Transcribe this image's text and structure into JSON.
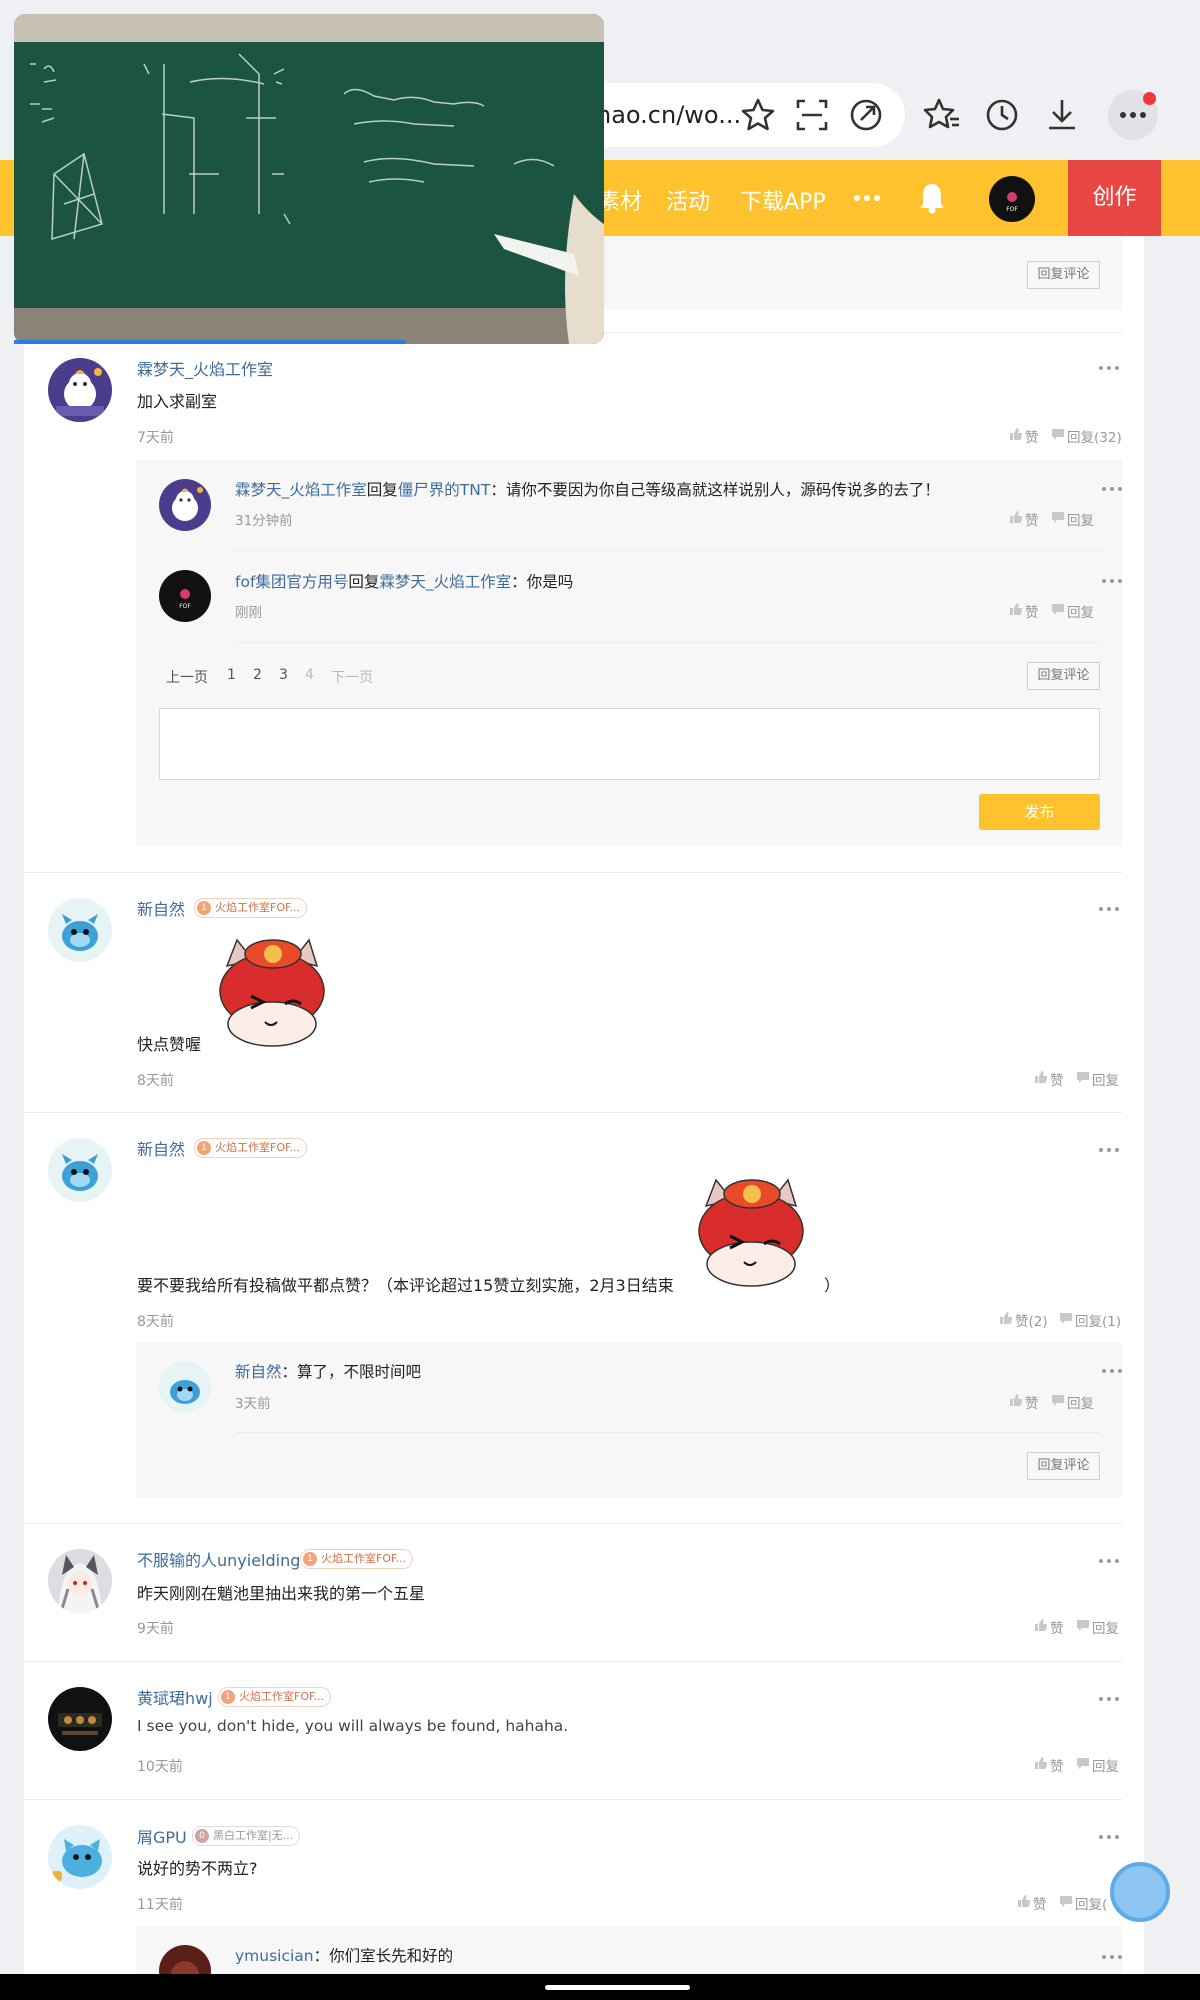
{
  "browser": {
    "url_visible": "hao.cn/wo...",
    "toolbar_icons": [
      "star-icon",
      "screenshot-icon",
      "share-icon",
      "favorites-icon",
      "history-icon",
      "download-icon",
      "more-icon"
    ]
  },
  "nav": {
    "items": [
      "素材",
      "活动",
      "下载APP"
    ],
    "create_label": "创作",
    "colors": {
      "bar": "#fdc22d",
      "create": "#e84744"
    }
  },
  "video": {
    "playing": true
  },
  "top_reply_btn": "回复评论",
  "comments": [
    {
      "author": "霖梦天_火焰工作室",
      "text": "加入求副室",
      "time": "7天前",
      "like": "赞",
      "reply": "回复(32)",
      "replies": [
        {
          "author": "霖梦天_火焰工作室",
          "connector": "回复",
          "target": "僵尸界的TNT",
          "text": "：请你不要因为你自己等级高就这样说别人，源码传说多的去了！",
          "time": "31分钟前",
          "like": "赞",
          "reply": "回复"
        },
        {
          "author": "fof集团官方用号",
          "connector": "回复",
          "target": "霖梦天_火焰工作室",
          "text": "：你是吗",
          "time": "刚刚",
          "like": "赞",
          "reply": "回复"
        }
      ],
      "pagination": {
        "prev": "上一页",
        "pages": [
          "1",
          "2",
          "3",
          "4"
        ],
        "next": "下一页"
      },
      "reply_comment_btn": "回复评论",
      "publish_btn": "发布"
    },
    {
      "author": "新自然",
      "badge_level": "1",
      "badge": "火焰工作室FOF...",
      "text": "快点赞喔",
      "time": "8天前",
      "like": "赞",
      "reply": "回复"
    },
    {
      "author": "新自然",
      "badge_level": "1",
      "badge": "火焰工作室FOF...",
      "text": "要不要我给所有投稿做平都点赞？（本评论超过15赞立刻实施，2月3日结束",
      "text_end": "）",
      "time": "8天前",
      "like": "赞(2)",
      "reply": "回复(1)",
      "replies": [
        {
          "author": "新自然",
          "text": "：算了，不限时间吧",
          "time": "3天前",
          "like": "赞",
          "reply": "回复"
        }
      ],
      "reply_comment_btn": "回复评论"
    },
    {
      "author": "不服输的人unyielding",
      "badge_level": "1",
      "badge": "火焰工作室FOF...",
      "text": "昨天刚刚在魈池里抽出来我的第一个五星",
      "time": "9天前",
      "like": "赞",
      "reply": "回复"
    },
    {
      "author": "黄珷珺hwj",
      "badge_level": "1",
      "badge": "火焰工作室FOF...",
      "text": "I see you, don't hide, you will always be found, hahaha.",
      "time": "10天前",
      "like": "赞",
      "reply": "回复"
    },
    {
      "author": "屑GPU",
      "badge_level": "0",
      "badge": "黑白工作室|无...",
      "text": "说好的势不两立?",
      "time": "11天前",
      "like": "赞",
      "reply": "回复(",
      "replies": [
        {
          "author": "ymusician",
          "text": "：你们室长先和好的"
        }
      ]
    }
  ]
}
